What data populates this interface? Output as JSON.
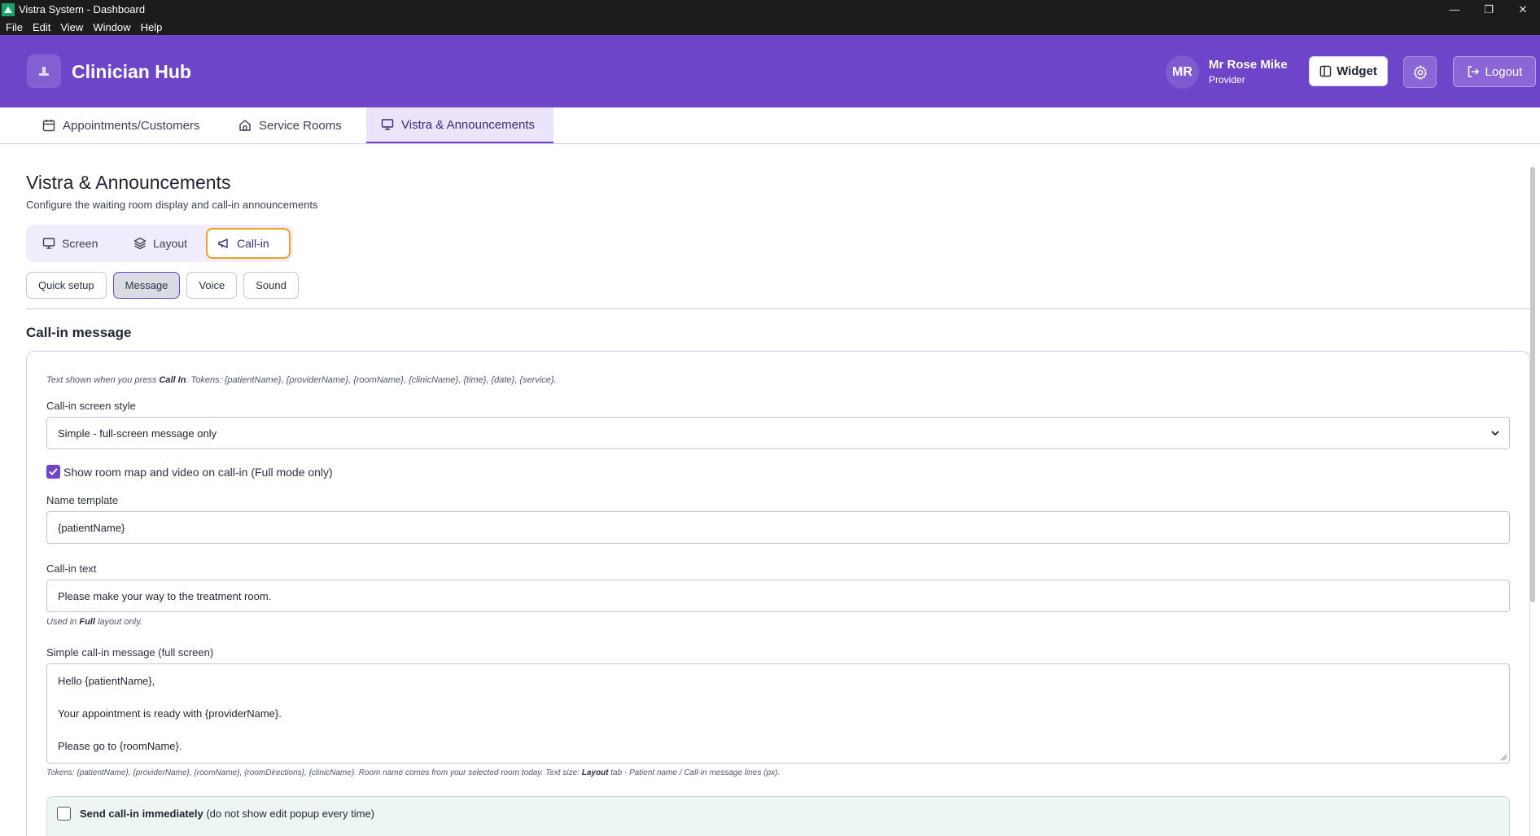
{
  "window": {
    "title": "Vistra System - Dashboard",
    "menu": [
      "File",
      "Edit",
      "View",
      "Window",
      "Help"
    ]
  },
  "header": {
    "brand": "Clinician Hub",
    "user_initials": "MR",
    "user_name": "Mr Rose Mike",
    "user_role": "Provider",
    "widget_label": "Widget",
    "logout_label": "Logout",
    "accent_color": "#6e45c9"
  },
  "main_tabs": [
    {
      "label": "Appointments/Customers",
      "icon": "calendar-icon"
    },
    {
      "label": "Service Rooms",
      "icon": "home-icon"
    },
    {
      "label": "Vistra & Announcements",
      "icon": "monitor-icon",
      "active": true
    }
  ],
  "page": {
    "title": "Vistra & Announcements",
    "subtitle": "Configure the waiting room display and call-in announcements"
  },
  "segments": [
    {
      "label": "Screen",
      "icon": "monitor-icon"
    },
    {
      "label": "Layout",
      "icon": "layers-icon"
    },
    {
      "label": "Call-in",
      "icon": "megaphone-icon",
      "active": true
    }
  ],
  "subtabs": [
    {
      "label": "Quick setup"
    },
    {
      "label": "Message",
      "active": true
    },
    {
      "label": "Voice"
    },
    {
      "label": "Sound"
    }
  ],
  "callin": {
    "section_title": "Call-in message",
    "hint_pre": "Text shown when you press ",
    "hint_bold": "Call In",
    "hint_post": ". Tokens: {patientName}, {providerName}, {roomName}, {clinicName}, {time}, {date}, {service}.",
    "style_label": "Call-in screen style",
    "style_value": "Simple - full-screen message only",
    "show_map_label": "Show room map and video on call-in (Full mode only)",
    "show_map_checked": true,
    "name_template_label": "Name template",
    "name_template_value": "{patientName}",
    "callin_text_label": "Call-in text",
    "callin_text_value": "Please make your way to the treatment room.",
    "full_hint_pre": "Used in ",
    "full_hint_bold": "Full",
    "full_hint_post": " layout only.",
    "simple_label": "Simple call-in message (full screen)",
    "simple_lines": [
      "Hello {patientName},",
      "Your appointment is ready with {providerName}.",
      "Please go to {roomName}."
    ],
    "tokens_hint_pre": "Tokens: {patientName}, {providerName}, {roomName}, {roomDirections}, {clinicName}. Room name comes from your selected room today. Text size: ",
    "tokens_hint_bold": "Layout",
    "tokens_hint_post": " tab - Patient name / Call-in message lines (px).",
    "immediate_bold": "Send call-in immediately",
    "immediate_rest": " (do not show edit popup every time)",
    "immediate_checked": false
  }
}
